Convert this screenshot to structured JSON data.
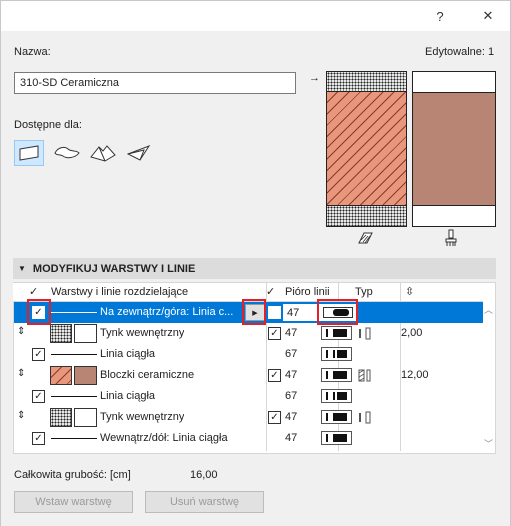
{
  "titlebar": {
    "help": "?",
    "close": "✕"
  },
  "name": {
    "label": "Nazwa:",
    "value": "310-SD Ceramiczna",
    "editable": "Edytowalne: 1"
  },
  "avail": {
    "label": "Dostępne dla:"
  },
  "section": {
    "arrow": "▼",
    "title": "MODYFIKUJ WARSTWY I LINIE"
  },
  "header": {
    "check": "✓",
    "layers": "Warstwy i linie rozdzielające",
    "pen_check": "✓",
    "pen": "Pióro linii",
    "type": "Typ",
    "thickness_icon": "⇳"
  },
  "rows": [
    {
      "label": "Na zewnątrz/góra: Linia c...",
      "pen": "47",
      "checked": true,
      "selected": true
    },
    {
      "label": "Tynk wewnętrzny",
      "pen": "47",
      "thickness": "2,00"
    },
    {
      "label": "Linia ciągła",
      "pen": "67"
    },
    {
      "label": "Bloczki ceramiczne",
      "pen": "47",
      "thickness": "12,00"
    },
    {
      "label": "Linia ciągła",
      "pen": "67"
    },
    {
      "label": "Tynk wewnętrzny",
      "pen": "47"
    },
    {
      "label": "Wewnątrz/dół: Linia ciągła",
      "pen": "47"
    }
  ],
  "totals": {
    "label": "Całkowita grubość: [cm]",
    "value": "16,00"
  },
  "buttons": {
    "insert": "Wstaw warstwę",
    "delete": "Usuń warstwę"
  },
  "colors": {
    "selection": "#0078d7",
    "ceramic": "#e8977d",
    "ceramic_fill": "#b88474",
    "highlight": "#e0202a"
  }
}
